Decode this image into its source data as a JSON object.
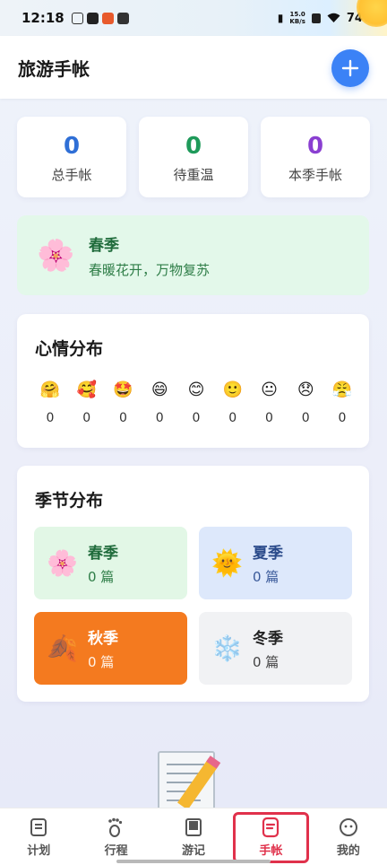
{
  "status_bar": {
    "time": "12:18",
    "speed_value": "15.0",
    "speed_unit": "KB/s",
    "battery": "74%"
  },
  "header": {
    "title": "旅游手帐",
    "add_label": "+"
  },
  "stats": [
    {
      "value": "0",
      "label": "总手帐",
      "color": "#2f6fd6"
    },
    {
      "value": "0",
      "label": "待重温",
      "color": "#1f9a5a"
    },
    {
      "value": "0",
      "label": "本季手帐",
      "color": "#8a3fd1"
    }
  ],
  "current_season": {
    "icon": "cherry-blossom",
    "emoji": "🌸",
    "name": "春季",
    "desc": "春暖花开，万物复苏"
  },
  "mood": {
    "title": "心情分布",
    "items": [
      {
        "emoji": "🤗",
        "count": "0"
      },
      {
        "emoji": "🥰",
        "count": "0"
      },
      {
        "emoji": "🤩",
        "count": "0"
      },
      {
        "emoji": "😄",
        "count": "0"
      },
      {
        "emoji": "😊",
        "count": "0"
      },
      {
        "emoji": "🙂",
        "count": "0"
      },
      {
        "emoji": "😐",
        "count": "0"
      },
      {
        "emoji": "😞",
        "count": "0"
      },
      {
        "emoji": "😤",
        "count": "0"
      }
    ]
  },
  "seasons": {
    "title": "季节分布",
    "items": [
      {
        "emoji": "🌸",
        "name": "春季",
        "count": "0 篇",
        "bg": "#e2f7e6",
        "fg": "#1f6b3b"
      },
      {
        "emoji": "🌞",
        "name": "夏季",
        "count": "0 篇",
        "bg": "#dde8fb",
        "fg": "#2a4a8a"
      },
      {
        "emoji": "🍂",
        "name": "秋季",
        "count": "0 篇",
        "bg": "#f47a1f",
        "fg": "#ffffff"
      },
      {
        "emoji": "❄️",
        "name": "冬季",
        "count": "0 篇",
        "bg": "#f1f2f4",
        "fg": "#333333"
      }
    ]
  },
  "tabs": [
    {
      "label": "计划",
      "icon": "plan-icon",
      "active": false
    },
    {
      "label": "行程",
      "icon": "footprint-icon",
      "active": false
    },
    {
      "label": "游记",
      "icon": "book-icon",
      "active": false
    },
    {
      "label": "手帐",
      "icon": "journal-icon",
      "active": true
    },
    {
      "label": "我的",
      "icon": "profile-icon",
      "active": false
    }
  ]
}
